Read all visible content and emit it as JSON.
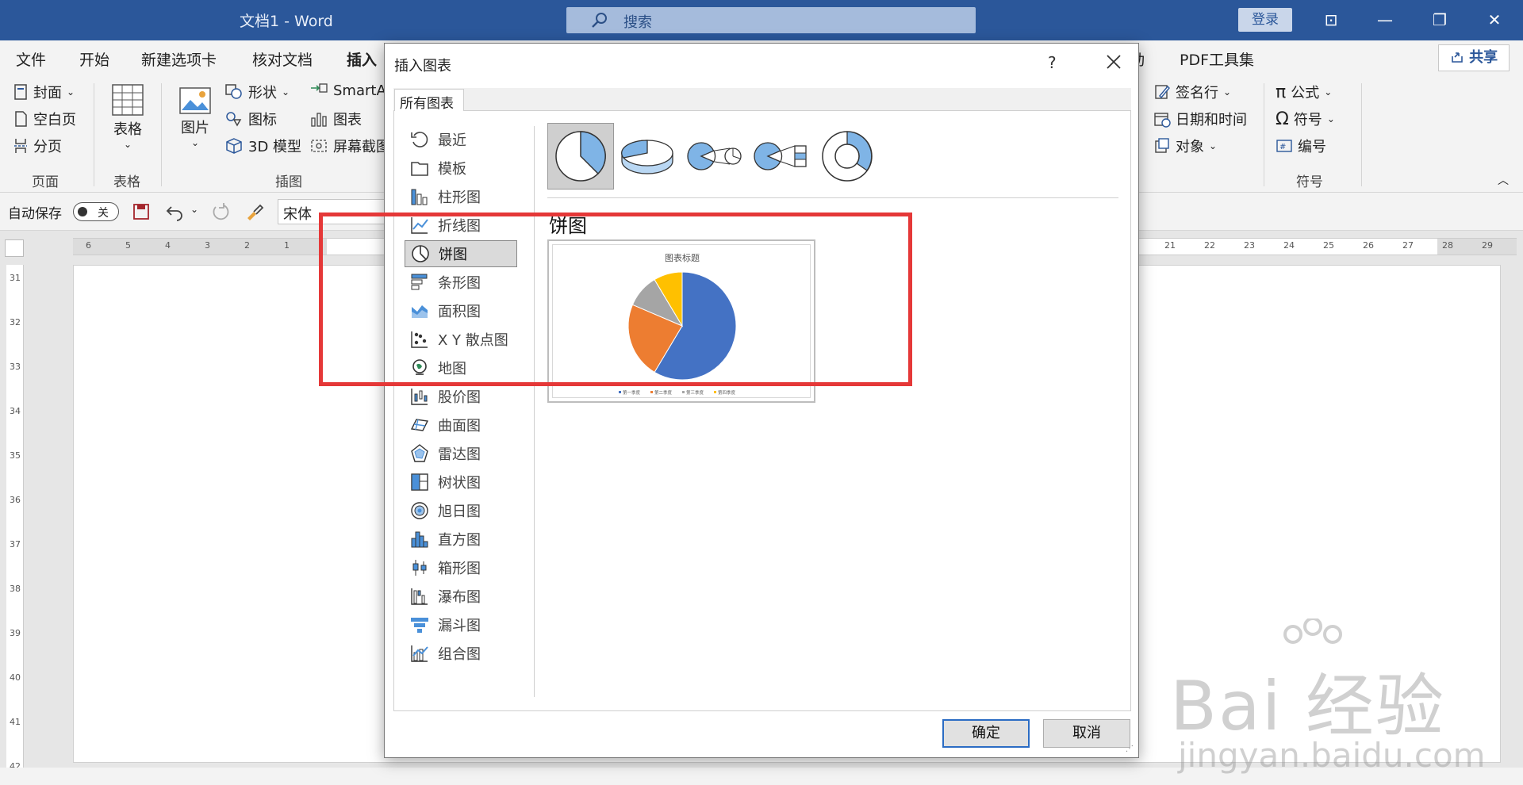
{
  "window": {
    "title": "文档1  -  Word",
    "search_placeholder": "搜索",
    "login": "登录",
    "controls": {
      "ribbon_display": "⊡",
      "minimize": "—",
      "restore": "❐",
      "close": "✕"
    }
  },
  "ribbon_tabs": [
    "文件",
    "开始",
    "新建选项卡",
    "核对文档",
    "插入",
    "动",
    "PDF工具集"
  ],
  "active_tab": "插入",
  "share": "共享",
  "ribbon": {
    "page_group": {
      "label": "页面",
      "items": [
        "封面",
        "空白页",
        "分页"
      ]
    },
    "table_group": {
      "label": "表格",
      "button": "表格"
    },
    "illustrations_group": {
      "label": "插图",
      "picture": "图片",
      "shapes": "形状",
      "icons": "图标",
      "model3d": "3D 模型",
      "smartart": "SmartAr",
      "chart": "图表",
      "screenshot": "屏幕截图"
    },
    "text_group": {
      "signature": "签名行",
      "datetime": "日期和时间",
      "object": "对象"
    },
    "symbols_group": {
      "label": "符号",
      "equation": "公式",
      "symbol": "符号",
      "number": "编号"
    }
  },
  "qat": {
    "autosave_label": "自动保存",
    "toggle_state": "关",
    "font_name": "宋体"
  },
  "ruler": {
    "h_left": [
      "6",
      "5",
      "4",
      "3",
      "2",
      "1"
    ],
    "h_right": [
      "21",
      "22",
      "23",
      "24",
      "25",
      "26",
      "27",
      "28",
      "29"
    ],
    "v": [
      "31",
      "32",
      "33",
      "34",
      "35",
      "36",
      "37",
      "38",
      "39",
      "40",
      "41",
      "42"
    ]
  },
  "dialog": {
    "title": "插入图表",
    "help": "?",
    "tab": "所有图表",
    "categories": [
      {
        "label": "最近",
        "icon": "recent-icon"
      },
      {
        "label": "模板",
        "icon": "template-icon"
      },
      {
        "label": "柱形图",
        "icon": "column-chart-icon"
      },
      {
        "label": "折线图",
        "icon": "line-chart-icon"
      },
      {
        "label": "饼图",
        "icon": "pie-chart-icon"
      },
      {
        "label": "条形图",
        "icon": "bar-chart-icon"
      },
      {
        "label": "面积图",
        "icon": "area-chart-icon"
      },
      {
        "label": "X Y 散点图",
        "icon": "scatter-chart-icon"
      },
      {
        "label": "地图",
        "icon": "map-chart-icon"
      },
      {
        "label": "股价图",
        "icon": "stock-chart-icon"
      },
      {
        "label": "曲面图",
        "icon": "surface-chart-icon"
      },
      {
        "label": "雷达图",
        "icon": "radar-chart-icon"
      },
      {
        "label": "树状图",
        "icon": "treemap-chart-icon"
      },
      {
        "label": "旭日图",
        "icon": "sunburst-chart-icon"
      },
      {
        "label": "直方图",
        "icon": "histogram-chart-icon"
      },
      {
        "label": "箱形图",
        "icon": "box-chart-icon"
      },
      {
        "label": "瀑布图",
        "icon": "waterfall-chart-icon"
      },
      {
        "label": "漏斗图",
        "icon": "funnel-chart-icon"
      },
      {
        "label": "组合图",
        "icon": "combo-chart-icon"
      }
    ],
    "selected_category": "饼图",
    "subtypes": [
      "pie",
      "3d-pie",
      "pie-of-pie",
      "bar-of-pie",
      "doughnut"
    ],
    "selected_subtype": "pie",
    "chart_type_title": "饼图",
    "preview_title": "图表标题",
    "ok": "确定",
    "cancel": "取消"
  },
  "chart_data": {
    "type": "pie",
    "title": "图表标题",
    "categories": [
      "第一季度",
      "第二季度",
      "第三季度",
      "第四季度"
    ],
    "values": [
      8.2,
      3.2,
      1.4,
      1.2
    ],
    "colors": [
      "#4472c4",
      "#ed7d31",
      "#a5a5a5",
      "#ffc000"
    ],
    "legend": "bottom"
  },
  "watermark": {
    "main": "Bai  经验",
    "sub": "jingyan.baidu.com"
  },
  "colors": {
    "word_blue": "#2b579a",
    "annotation_red": "#e53838",
    "selected_gray": "#dadada"
  }
}
